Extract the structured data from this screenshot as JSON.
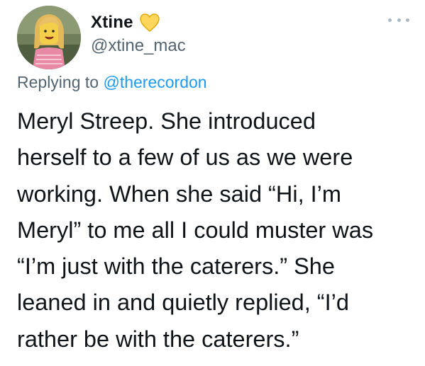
{
  "author": {
    "display_name": "Xtine",
    "handle": "@xtine_mac",
    "badge_icon": "yellow-heart-icon",
    "avatar_icon": "lego-minifigure-avatar"
  },
  "reply": {
    "prefix": "Replying to",
    "mention": "@therecordon"
  },
  "tweet": {
    "lines": [
      "Meryl Streep. She introduced",
      "herself to a few of us as we were",
      "working. When she said “Hi, I’m",
      "Meryl” to me all I could muster was",
      "“I’m just with the caterers.” She",
      "leaned in and quietly replied, “I’d",
      "rather be with the caterers.”"
    ]
  },
  "colors": {
    "text": "#0f1419",
    "secondary": "#536471",
    "link": "#1d9bf0",
    "heart": "#ffd65c"
  }
}
